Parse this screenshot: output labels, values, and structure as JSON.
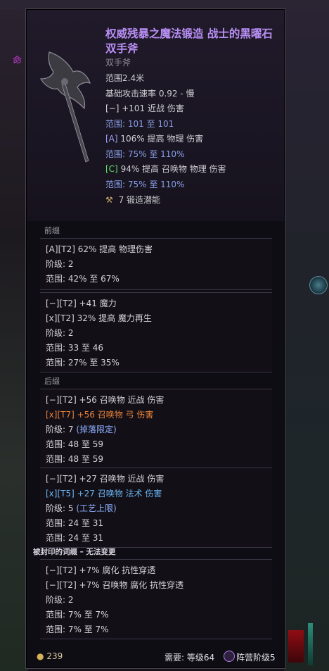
{
  "item": {
    "title": "权威残暴之魔法锻造 战士的黑曜石双手斧",
    "type": "双手斧",
    "range": "范围2.4米",
    "attack_speed": "基础攻击速率 0.92 - 慢",
    "implicit1": "[−] +101 近战 伤害",
    "implicit1_range": "范围: 101 至 101",
    "implicit2_tag": "[A]",
    "implicit2": "106% 提高 物理 伤害",
    "implicit2_range": "范围: 75% 至 110%",
    "implicit3_tag": "[C]",
    "implicit3": "94% 提高 召唤物 物理 伤害",
    "implicit3_range": "范围: 75% 至 110%",
    "forge": "7 锻造潜能"
  },
  "prefix": {
    "label": "前缀",
    "box1": {
      "line1": "[A][T2] 62% 提高 物理伤害",
      "tier": "阶级: 2",
      "range": "范围: 42% 至 67%"
    },
    "box2": {
      "line1": "[−][T2] +41 魔力",
      "line2": "[x][T2] 32% 提高 魔力再生",
      "tier": "阶级: 2",
      "range1": "范围: 33 至 46",
      "range2": "范围: 27% 至 35%"
    }
  },
  "suffix": {
    "label": "后缀",
    "box1": {
      "line1": "[−][T2] +56 召唤物 近战 伤害",
      "line2": "[x][T7] +56 召唤物 弓 伤害",
      "tier": "阶级: 7",
      "tier_note": "(掉落限定)",
      "range1": "范围: 48 至 59",
      "range2": "范围: 48 至 59"
    },
    "box2": {
      "line1": "[−][T2] +27 召唤物 近战 伤害",
      "line2": "[x][T5] +27 召唤物 法术 伤害",
      "tier": "阶级: 5",
      "tier_note": "(工艺上限)",
      "range1": "范围: 24 至 31",
      "range2": "范围: 24 至 31"
    }
  },
  "sealed": {
    "label": "被封印的词缀 – 无法变更",
    "line1": "[−][T2] +7% 腐化 抗性穿透",
    "line2": "[−][T2] +7% 召唤物 腐化 抗性穿透",
    "tier": "阶级: 2",
    "range1": "范围: 7% 至 7%",
    "range2": "范围: 7% 至 7%"
  },
  "footer": {
    "gold": "239",
    "requirement": "需要: 等级64",
    "faction": "阵营阶级5"
  },
  "colors": {
    "title": "#b98ff5",
    "range": "#8a9fe8",
    "green": "#66e06a",
    "orange": "#e8823a",
    "blue": "#6ab4f0"
  }
}
